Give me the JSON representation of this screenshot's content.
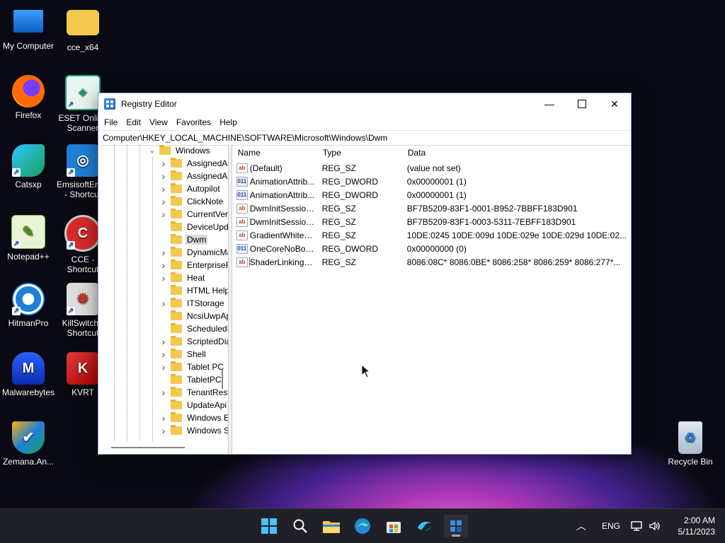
{
  "desktop": {
    "icons": [
      {
        "label": "My Computer"
      },
      {
        "label": "cce_x64"
      },
      {
        "label": "Firefox"
      },
      {
        "label": "ESET Online Scanner"
      },
      {
        "label": "Catsxp"
      },
      {
        "label": "EmsisoftEm... - Shortcut"
      },
      {
        "label": "Notepad++"
      },
      {
        "label": "CCE - Shortcut"
      },
      {
        "label": "HitmanPro"
      },
      {
        "label": "KillSwitch - Shortcut"
      },
      {
        "label": "Malwarebytes"
      },
      {
        "label": "KVRT"
      },
      {
        "label": "Zemana.An..."
      },
      {
        "label": "Recycle Bin"
      }
    ]
  },
  "window": {
    "title": "Registry Editor",
    "menu": [
      "File",
      "Edit",
      "View",
      "Favorites",
      "Help"
    ],
    "address": "Computer\\HKEY_LOCAL_MACHINE\\SOFTWARE\\Microsoft\\Windows\\Dwm",
    "tree": {
      "parent": "Windows",
      "items": [
        {
          "label": "AssignedAcce",
          "expandable": true
        },
        {
          "label": "AssignedAcce",
          "expandable": true
        },
        {
          "label": "Autopilot",
          "expandable": true
        },
        {
          "label": "ClickNote",
          "expandable": true
        },
        {
          "label": "CurrentVersion",
          "expandable": true
        },
        {
          "label": "DeviceUpdate",
          "expandable": false
        },
        {
          "label": "Dwm",
          "expandable": false,
          "selected": true
        },
        {
          "label": "DynamicMana",
          "expandable": true
        },
        {
          "label": "EnterpriseResc",
          "expandable": true
        },
        {
          "label": "Heat",
          "expandable": true
        },
        {
          "label": "HTML Help",
          "expandable": false
        },
        {
          "label": "ITStorage",
          "expandable": true
        },
        {
          "label": "NcsiUwpApp",
          "expandable": false
        },
        {
          "label": "ScheduledDiag",
          "expandable": false
        },
        {
          "label": "ScriptedDiagn",
          "expandable": true
        },
        {
          "label": "Shell",
          "expandable": true
        },
        {
          "label": "Tablet PC",
          "expandable": true
        },
        {
          "label": "TabletPC",
          "expandable": false
        },
        {
          "label": "TenantRestrict",
          "expandable": true
        },
        {
          "label": "UpdateApi",
          "expandable": false
        },
        {
          "label": "Windows Error",
          "expandable": true
        },
        {
          "label": "Windows Sear",
          "expandable": true
        }
      ]
    },
    "list": {
      "columns": [
        "Name",
        "Type",
        "Data"
      ],
      "rows": [
        {
          "name": "(Default)",
          "type": "REG_SZ",
          "data": "(value not set)",
          "icon": "ab"
        },
        {
          "name": "AnimationAttrib...",
          "type": "REG_DWORD",
          "data": "0x00000001 (1)",
          "icon": "dw"
        },
        {
          "name": "AnimationAttrib...",
          "type": "REG_DWORD",
          "data": "0x00000001 (1)",
          "icon": "dw"
        },
        {
          "name": "DwmInitSession...",
          "type": "REG_SZ",
          "data": "BF7B5209-83F1-0001-B952-7BBFF183D901",
          "icon": "ab"
        },
        {
          "name": "DwmInitSession...",
          "type": "REG_SZ",
          "data": "BF7B5209-83F1-0003-5311-7EBFF183D901",
          "icon": "ab"
        },
        {
          "name": "GradientWhitePi...",
          "type": "REG_SZ",
          "data": "10DE:0245 10DE:009d 10DE:029e 10DE:029d 10DE:02...",
          "icon": "ab"
        },
        {
          "name": "OneCoreNoBoo...",
          "type": "REG_DWORD",
          "data": "0x00000000 (0)",
          "icon": "dw"
        },
        {
          "name": "ShaderLinkingG...",
          "type": "REG_SZ",
          "data": "8086:08C* 8086:0BE* 8086:258* 8086:259* 8086:277*...",
          "icon": "ab"
        }
      ]
    }
  },
  "taskbar": {
    "lang": "ENG",
    "time": "2:00 AM",
    "date": "5/11/2023"
  }
}
